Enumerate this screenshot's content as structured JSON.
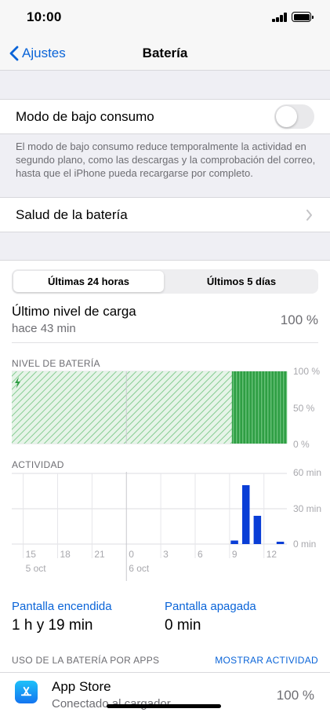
{
  "status_bar": {
    "time": "10:00"
  },
  "nav": {
    "back_label": "Ajustes",
    "title": "Batería"
  },
  "low_power": {
    "label": "Modo de bajo consumo",
    "enabled": false,
    "note": "El modo de bajo consumo reduce temporalmente la actividad en segundo plano, como las descargas y la comprobación del correo, hasta que el iPhone pueda recargarse por completo."
  },
  "battery_health": {
    "label": "Salud de la batería"
  },
  "segments": {
    "options": [
      "Últimas 24 horas",
      "Últimos 5 días"
    ],
    "selected": 0
  },
  "last_charge": {
    "title": "Último nivel de carga",
    "subtitle": "hace 43 min",
    "value": "100 %"
  },
  "colors": {
    "accent": "#0a64d8",
    "battery_green": "#2f9e44",
    "activity_bar": "#0a3ed6"
  },
  "chart_data": [
    {
      "type": "area",
      "title": "NIVEL DE BATERÍA",
      "y_ticks": [
        "100 %",
        "50 %",
        "0 %"
      ],
      "ylim": [
        0,
        100
      ],
      "x_ticks": [
        "15",
        "18",
        "21",
        "0",
        "3",
        "6",
        "9",
        "12"
      ],
      "levels": [
        100,
        100,
        100,
        100,
        100,
        100,
        100,
        100,
        100,
        100,
        100,
        100,
        100,
        100,
        100,
        100,
        100,
        100,
        100,
        100,
        100,
        100,
        100,
        100,
        100,
        100,
        100,
        100,
        100,
        100,
        100,
        100,
        100,
        100,
        100
      ],
      "charging_icon": "bolt-icon"
    },
    {
      "type": "bar",
      "title": "ACTIVIDAD",
      "y_ticks": [
        "60 min",
        "30 min",
        "0 min"
      ],
      "ylim": [
        0,
        60
      ],
      "x_ticks": [
        "15",
        "18",
        "21",
        "0",
        "3",
        "6",
        "9",
        "12"
      ],
      "date_labels": [
        "5 oct",
        "6 oct"
      ],
      "bars": [
        {
          "hour": 9,
          "minutes": 3
        },
        {
          "hour": 10,
          "minutes": 50
        },
        {
          "hour": 11,
          "minutes": 24
        },
        {
          "hour": 13,
          "minutes": 2
        }
      ]
    }
  ],
  "screen_stats": {
    "on": {
      "label": "Pantalla encendida",
      "value": "1 h y 19 min"
    },
    "off": {
      "label": "Pantalla apagada",
      "value": "0 min"
    }
  },
  "app_usage": {
    "header": "USO DE LA BATERÍA POR APPS",
    "action": "MOSTRAR ACTIVIDAD",
    "apps": [
      {
        "name": "App Store",
        "detail": "Conectado al cargador",
        "percent": "100 %",
        "icon": "app-store-icon"
      }
    ]
  }
}
